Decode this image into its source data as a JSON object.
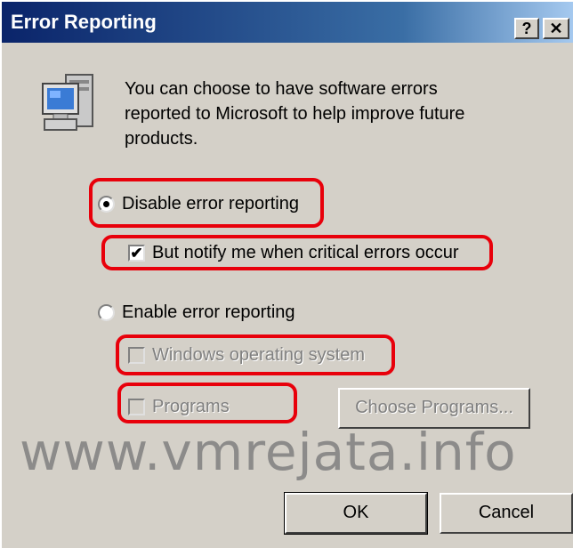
{
  "window": {
    "title": "Error Reporting",
    "help_label": "?",
    "close_label": "✕"
  },
  "intro_text": "You can choose to have software errors reported to Microsoft to help improve future products.",
  "options": {
    "disable_label": "Disable error reporting",
    "notify_label": "But notify me when critical errors occur",
    "enable_label": "Enable error reporting",
    "windows_label": "Windows operating system",
    "programs_label": "Programs"
  },
  "state": {
    "disable_selected": true,
    "notify_checked": true,
    "enable_selected": false,
    "windows_checked": false,
    "programs_checked": false
  },
  "buttons": {
    "choose_programs": "Choose Programs...",
    "ok": "OK",
    "cancel": "Cancel"
  },
  "watermark": "www.vmrejata.info",
  "icons": {
    "app_icon": "computer-icon",
    "check_mark": "✔"
  },
  "colors": {
    "highlight": "#e8000b",
    "titlebar": "#0a246a",
    "dialog_bg": "#d4d0c8"
  }
}
